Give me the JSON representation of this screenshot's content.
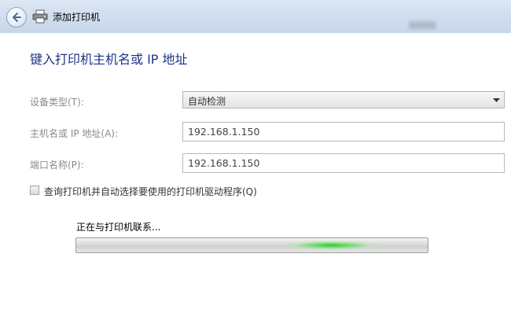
{
  "window": {
    "title": "添加打印机"
  },
  "page": {
    "heading": "键入打印机主机名或 IP 地址"
  },
  "form": {
    "device_type_label": "设备类型(T):",
    "device_type_value": "自动检测",
    "hostname_label": "主机名或 IP 地址(A):",
    "hostname_value": "192.168.1.150",
    "port_label": "端口名称(P):",
    "port_value": "192.168.1.150",
    "query_checkbox_label": "查询打印机并自动选择要使用的打印机驱动程序(Q)",
    "query_checked": false
  },
  "status": {
    "text": "正在与打印机联系...",
    "progress_state": "indeterminate"
  },
  "colors": {
    "heading": "#1e3287",
    "progress_glow": "#28d228"
  },
  "icons": {
    "back": "back-arrow-icon",
    "printer": "printer-icon",
    "dropdown": "chevron-down-icon"
  }
}
